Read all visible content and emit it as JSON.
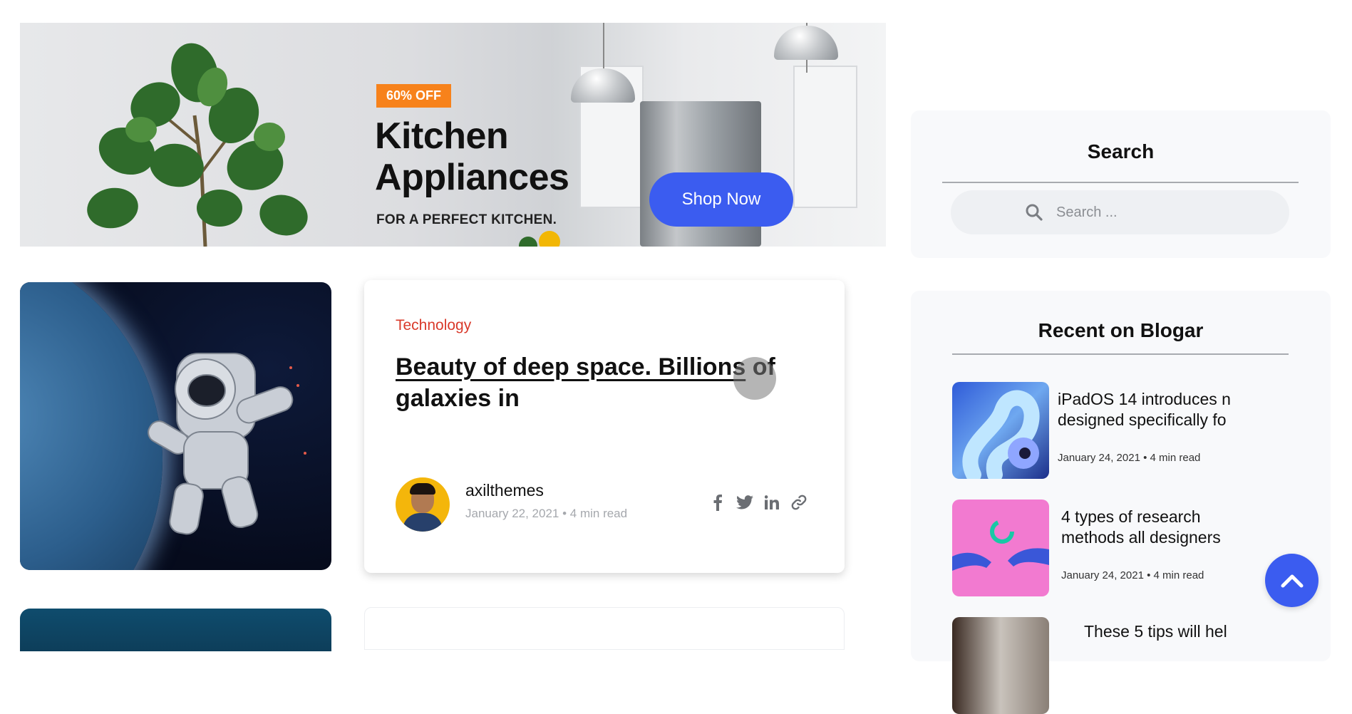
{
  "banner": {
    "discount_tag": "60% OFF",
    "headline_line1": "Kitchen",
    "headline_line2": "Appliances",
    "subline": "FOR A PERFECT KITCHEN.",
    "cta_label": "Shop Now"
  },
  "post": {
    "category": "Technology",
    "title_underlined": "Beauty of deep space. Billions",
    "title_rest_line1": " of",
    "title_line2": "galaxies in",
    "author": "axilthemes",
    "meta": "January 22, 2021 • 4 min read",
    "social_icons": [
      "facebook-icon",
      "twitter-icon",
      "linkedin-icon",
      "link-icon"
    ]
  },
  "sidebar": {
    "search": {
      "title": "Search",
      "placeholder": "Search ..."
    },
    "recent": {
      "title": "Recent on Blogar",
      "items": [
        {
          "title_line1": "iPadOS 14 introduces n",
          "title_line2": "designed specifically fo",
          "meta": "January 24, 2021 • 4 min read"
        },
        {
          "title_line1": "4 types of research",
          "title_line2": "methods all designers",
          "meta": "January 24, 2021 • 4 min read"
        },
        {
          "title_line1": "These 5 tips will hel",
          "title_line2": "",
          "meta": ""
        }
      ]
    }
  },
  "colors": {
    "accent_blue": "#3b5cf0",
    "tag_orange": "#f7821b",
    "category_red": "#d93a2b",
    "widget_bg": "#f8f9fb"
  },
  "icons": {
    "back_to_top": "chevron-up-icon",
    "search": "search-icon"
  }
}
